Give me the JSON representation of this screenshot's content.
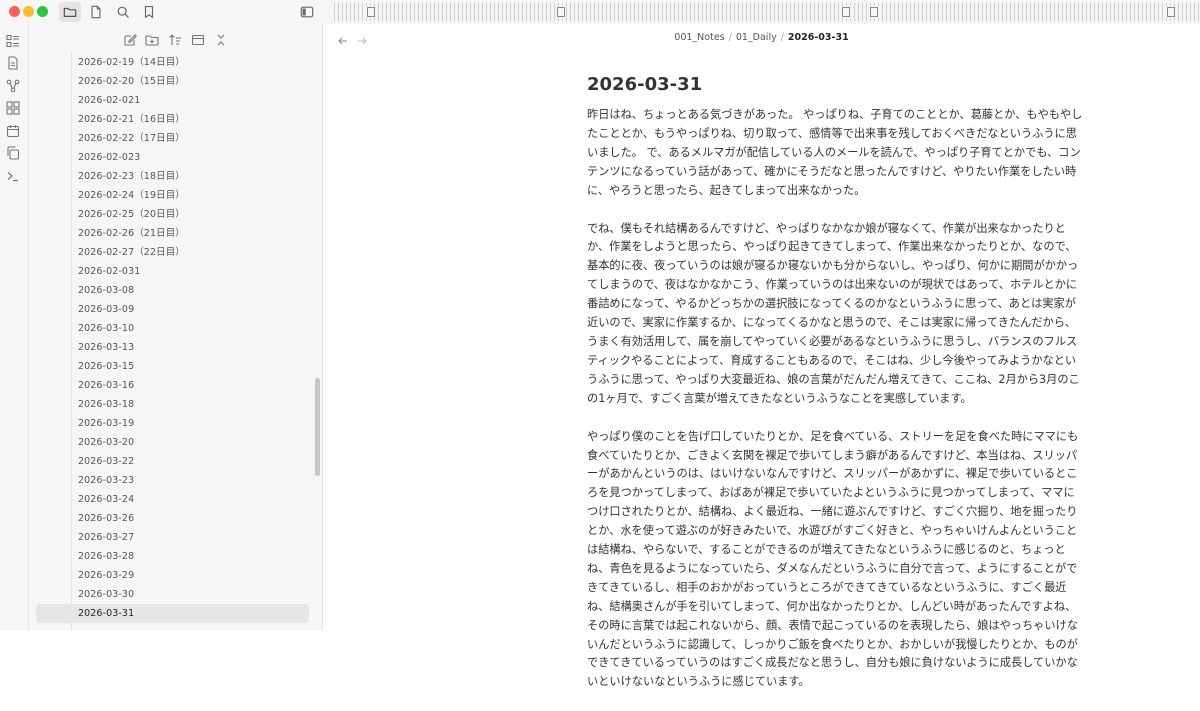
{
  "titlebar": {
    "buttons": [
      "files-icon",
      "page-icon",
      "search-icon",
      "bookmark-icon"
    ],
    "right_button": "sidebar-toggle-icon"
  },
  "ribbon": {
    "icons": [
      "list-icon",
      "file-icon",
      "graph-icon",
      "apps-icon",
      "calendar-icon",
      "copy-icon",
      "terminal-icon"
    ]
  },
  "sidebar": {
    "tools": [
      "new-note-icon",
      "new-folder-icon",
      "sort-icon",
      "collapse-view-icon",
      "collapse-all-icon"
    ],
    "files": [
      "2026-02-19（14日目）",
      "2026-02-20（15日目）",
      "2026-02-021",
      "2026-02-21（16日目）",
      "2026-02-22（17日目）",
      "2026-02-023",
      "2026-02-23（18日目）",
      "2026-02-24（19日目）",
      "2026-02-25（20日目）",
      "2026-02-26（21日目）",
      "2026-02-27（22日目）",
      "2026-02-031",
      "2026-03-08",
      "2026-03-09",
      "2026-03-10",
      "2026-03-13",
      "2026-03-15",
      "2026-03-16",
      "2026-03-18",
      "2026-03-19",
      "2026-03-20",
      "2026-03-22",
      "2026-03-23",
      "2026-03-24",
      "2026-03-26",
      "2026-03-27",
      "2026-03-28",
      "2026-03-29",
      "2026-03-30",
      "2026-03-31"
    ],
    "active_file": "2026-03-31"
  },
  "main": {
    "breadcrumb": {
      "folder1": "001_Notes",
      "folder2": "01_Daily",
      "current": "2026-03-31",
      "separator": "/"
    },
    "title": "2026-03-31",
    "paragraphs": [
      "昨日はね、ちょっとある気づきがあった。 やっぱりね、子育てのこととか、葛藤とか、もやもやしたこととか、もうやっぱりね、切り取って、感情等で出来事を残しておくべきだなというふうに思いました。 で、あるメルマガが配信している人のメールを読んで、やっぱり子育てとかでも、コンテンツになるっていう話があって、確かにそうだなと思ったんですけど、やりたい作業をしたい時に、やろうと思ったら、起きてしまって出来なかった。",
      "でね、僕もそれ結構あるんですけど、やっぱりなかなか娘が寝なくて、作業が出来なかったりとか、作業をしようと思ったら、やっぱり起きてきてしまって、作業出来なかったりとか、なので、基本的に夜、夜っていうのは娘が寝るか寝ないかも分からないし、やっぱり、何かに期間がかかってしまうので、夜はなかなかこう、作業っていうのは出来ないのが現状ではあって、ホテルとかに番詰めになって、やるかどっちかの選択肢になってくるのかなというふうに思って、あとは実家が近いので、実家に作業するか、になってくるかなと思うので、そこは実家に帰ってきたんだから、うまく有効活用して、属を崩してやっていく必要があるなというふうに思うし、バランスのフルスティックやることによって、育成することもあるので、そこはね、少し今後やってみようかなというふうに思って、やっぱり大変最近ね、娘の言葉がだんだん増えてきて、ここね、2月から3月のこの1ヶ月で、すごく言葉が増えてきたなというふうなことを実感しています。",
      "やっぱり僕のことを告げ口していたりとか、足を食べている、ストリーを足を食べた時にママにも食べていたりとか、ごきよく玄関を裸足で歩いてしまう癖があるんですけど、本当はね、スリッパーがあかんというのは、はいけないなんですけど、スリッパーがあかずに、裸足で歩いているところを見つかってしまって、おばあが裸足で歩いていたよというふうに見つかってしまって、ママにつけ口されたりとか、結構ね、よく最近ね、一緒に遊ぶんですけど、すごく穴掘り、地を掘ったりとか、水を使って遊ぶのが好きみたいで、水遊びがすごく好きと、やっちゃいけんよんということは結構ね、やらないで、することができるのが増えてきたなというふうに感じるのと、ちょっとね、青色を見るようになっていたら、ダメなんだというふうに自分で言って、ようにすることができてきているし、相手のおかがおっていうところができてきているなというふうに、すごく最近ね、結構奥さんが手を引いてしまって、何か出なかったりとか、しんどい時があったんですよね、その時に言葉では起これないから、顔、表情で起こっているのを表現したら、娘はやっちゃいけないんだというふうに認識して、しっかりご飯を食べたりとか、おかしいが我慢したりとか、ものができてきているっていうのはすごく成長だなと思うし、自分も娘に負けないように成長していかないといけないなというふうに感じています。"
    ]
  }
}
